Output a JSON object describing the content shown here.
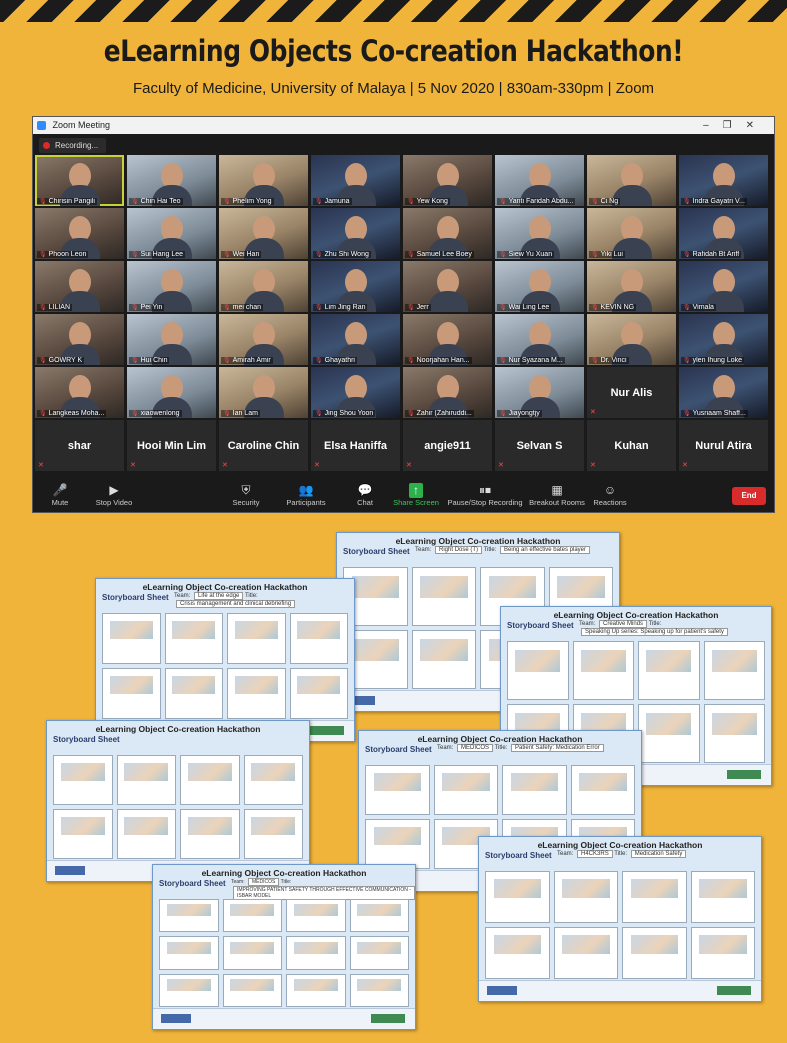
{
  "poster": {
    "title": "eLearning Objects Co-creation Hackathon!",
    "subtitle": "Faculty of Medicine, University of Malaya | 5 Nov 2020 | 830am-330pm | Zoom"
  },
  "zoom": {
    "window_title": "Zoom Meeting",
    "recording_label": "Recording...",
    "participants": [
      {
        "name": "Chirisin Pangili",
        "video": true
      },
      {
        "name": "Chin Hai Teo",
        "video": true
      },
      {
        "name": "Phelim Yong",
        "video": true
      },
      {
        "name": "Jamuna",
        "video": true
      },
      {
        "name": "Yew Kong",
        "video": true
      },
      {
        "name": "Yanti Faridah Abdu...",
        "video": true
      },
      {
        "name": "Ci Ng",
        "video": true
      },
      {
        "name": "Indra Gayatri V...",
        "video": true
      },
      {
        "name": "Phoon Leon",
        "video": true
      },
      {
        "name": "Sui Hang Lee",
        "video": true
      },
      {
        "name": "Wei Han",
        "video": true
      },
      {
        "name": "Zhu Shi Wong",
        "video": true
      },
      {
        "name": "Samuel Lee Boey",
        "video": true
      },
      {
        "name": "Siew Yu Xuan",
        "video": true
      },
      {
        "name": "Yiki Lui",
        "video": true
      },
      {
        "name": "Rafidah Bt Ariff",
        "video": true
      },
      {
        "name": "LILIAN",
        "video": true
      },
      {
        "name": "Pei Yin",
        "video": true
      },
      {
        "name": "mei chan",
        "video": true
      },
      {
        "name": "Lim Jing Ran",
        "video": true
      },
      {
        "name": "Jerr",
        "video": true
      },
      {
        "name": "Wai Ling Lee",
        "video": true
      },
      {
        "name": "KEVIN NG",
        "video": true
      },
      {
        "name": "Vimala",
        "video": true
      },
      {
        "name": "GOWRY K",
        "video": true
      },
      {
        "name": "Hui Chin",
        "video": true
      },
      {
        "name": "Amirah Amir",
        "video": true
      },
      {
        "name": "Ghayathri",
        "video": true
      },
      {
        "name": "Noorjahan Han...",
        "video": true
      },
      {
        "name": "Nur Syazana M...",
        "video": true
      },
      {
        "name": "Dr. Vinci",
        "video": true
      },
      {
        "name": "ylen Ihung Loke",
        "video": true
      },
      {
        "name": "Langkeas Moha...",
        "video": true
      },
      {
        "name": "xiaowenlong",
        "video": true
      },
      {
        "name": "Ian Lam",
        "video": true
      },
      {
        "name": "Jing Shou Yoon",
        "video": true
      },
      {
        "name": "Zahir (Zahiruddi...",
        "video": true
      },
      {
        "name": "Jiayongtjy",
        "video": true
      },
      {
        "name": "Nur Alis",
        "video": false
      },
      {
        "name": "Yusriaam Shaff...",
        "video": true
      },
      {
        "name": "shar",
        "video": false
      },
      {
        "name": "Hooi Min Lim",
        "video": false
      },
      {
        "name": "Caroline Chin",
        "video": false
      },
      {
        "name": "Elsa Haniffa",
        "video": false
      },
      {
        "name": "angie911",
        "video": false
      },
      {
        "name": "Selvan S",
        "video": false
      },
      {
        "name": "Kuhan",
        "video": false
      },
      {
        "name": "Nurul Atira",
        "video": false
      }
    ],
    "toolbar": {
      "mute": "Mute",
      "stop_video": "Stop Video",
      "security": "Security",
      "participants": "Participants",
      "chat": "Chat",
      "share_screen": "Share Screen",
      "pause_recording": "Pause/Stop Recording",
      "breakout_rooms": "Breakout Rooms",
      "reactions": "Reactions",
      "end": "End"
    }
  },
  "sheets_common": {
    "header": "eLearning Object Co-creation Hackathon",
    "storyboard_label": "Storyboard Sheet"
  },
  "sheets": [
    {
      "team": "Right Dose (T)",
      "title": "Being an effective bates player"
    },
    {
      "team": "Life at the edge",
      "title": "Crisis management and clinical debriefing"
    },
    {
      "team": "Creative Minds",
      "title": "Speaking Up series: Speaking up for patient's safety"
    },
    {
      "team": "",
      "title": ""
    },
    {
      "team": "MEDICOS",
      "title": "Patient Safety: Medication Error"
    },
    {
      "team": "H4CK3RS",
      "title": "Medication Safety"
    },
    {
      "team": "MEDICOS",
      "title": "IMPROVING PATIENT SAFETY THROUGH EFFECTIVE COMMUNICATION - ISBAR MODEL"
    }
  ],
  "colors": {
    "background": "#f0b43a",
    "zoom_bg": "#1a1a1a",
    "end_button": "#d82c2c",
    "share_green": "#2db14b",
    "sheet_bg": "#dbe9f6"
  }
}
